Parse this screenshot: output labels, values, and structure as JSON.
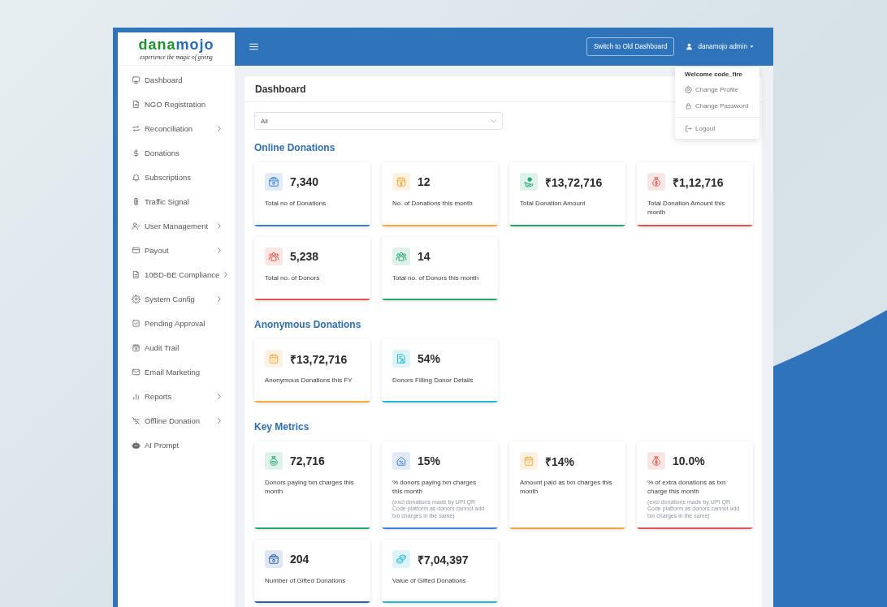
{
  "logo": {
    "parts": [
      "dana",
      "mojo"
    ],
    "tagline": "experience the magic of giving"
  },
  "sidebar": {
    "items": [
      {
        "label": "Dashboard",
        "submenu": false
      },
      {
        "label": "NGO Registration",
        "submenu": false
      },
      {
        "label": "Reconciliation",
        "submenu": true
      },
      {
        "label": "Donations",
        "submenu": false
      },
      {
        "label": "Subscriptions",
        "submenu": false
      },
      {
        "label": "Traffic Signal",
        "submenu": false
      },
      {
        "label": "User Management",
        "submenu": true
      },
      {
        "label": "Payout",
        "submenu": true
      },
      {
        "label": "10BD-BE Compliance",
        "submenu": true
      },
      {
        "label": "System Config",
        "submenu": true
      },
      {
        "label": "Pending Approval",
        "submenu": false
      },
      {
        "label": "Audit Trail",
        "submenu": false
      },
      {
        "label": "Email Marketing",
        "submenu": false
      },
      {
        "label": "Reports",
        "submenu": true
      },
      {
        "label": "Offline Donation",
        "submenu": true
      },
      {
        "label": "AI Prompt",
        "submenu": false
      }
    ]
  },
  "header": {
    "switch_button": "Switch to Old Dashboard",
    "user": {
      "name": "danamojo admin",
      "expanded": true,
      "greeting": "Welcome code_fire",
      "menu_groups": [
        [
          "Change Profile",
          "Change Password"
        ],
        [
          "Logout"
        ]
      ]
    }
  },
  "dashboard": {
    "title": "Dashboard",
    "filter": {
      "value": "All"
    },
    "sections": [
      {
        "title": "Online Donations",
        "cards": [
          {
            "value": "7,340",
            "label": "Total no of Donations",
            "color": "#3b7dd8"
          },
          {
            "value": "12",
            "label": "No. of Donations this month",
            "color": "#f2a93b"
          },
          {
            "value": "₹13,72,716",
            "label": "Total Donation Amount",
            "color": "#24a66b"
          },
          {
            "value": "₹1,12,716",
            "label": "Total Donation Amount this month",
            "color": "#e0564a"
          },
          {
            "value": "5,238",
            "label": "Total no. of Donors",
            "color": "#e0564a"
          },
          {
            "value": "14",
            "label": "Total no. of Donors this month",
            "color": "#24a66b"
          }
        ]
      },
      {
        "title": "Anonymous Donations",
        "cards": [
          {
            "value": "₹13,72,716",
            "label": "Anonymous Donations this FY",
            "color": "#f2a93b"
          },
          {
            "value": "54%",
            "label": "Donors Filling Donor Details",
            "color": "#22b8d6"
          }
        ]
      },
      {
        "title": "Key Metrics",
        "cards": [
          {
            "value": "72,716",
            "label": "Donors paying txn charges this month",
            "color": "#24a66b"
          },
          {
            "value": "15%",
            "label": "% donors paying txn charges this month",
            "note": "(excl donations made by UPI QR Code platform as donors cannot add txn charges in the same)",
            "color": "#3b7dd8"
          },
          {
            "value": "₹14%",
            "label": "Amount paid as txn charges this month",
            "color": "#f2a93b"
          },
          {
            "value": "10.0%",
            "label": "% of extra donations as txn charge this month",
            "note": "(excl donations made by UPI QR Code platform as donors cannot add txn charges in the same)",
            "color": "#e0564a"
          },
          {
            "value": "204",
            "label": "Number of Gifted Donations",
            "color": "#2e5fa6"
          },
          {
            "value": "₹7,04,397",
            "label": "Value of Gifted Donations",
            "color": "#22b8d6"
          }
        ]
      }
    ]
  }
}
